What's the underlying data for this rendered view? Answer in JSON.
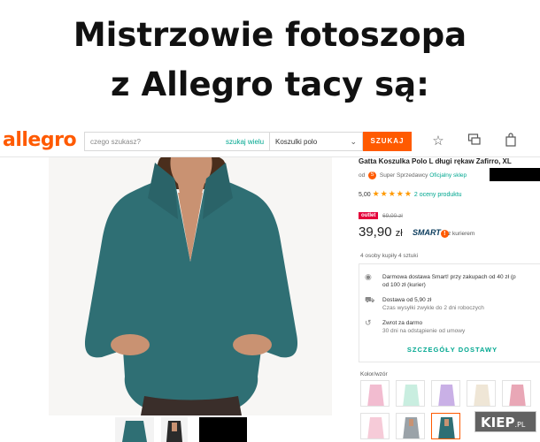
{
  "meme": {
    "line1": "Mistrzowie fotoszopa",
    "line2": "z Allegro tacy są:"
  },
  "header": {
    "logo": "allegro",
    "search_placeholder": "czego szukasz?",
    "search_link": "szukaj wielu",
    "category": "Koszulki polo",
    "search_button": "SZUKAJ",
    "icons": [
      "star-icon",
      "chat-icon",
      "bag-icon"
    ]
  },
  "product": {
    "title": "Gatta Koszulka Polo L długi rękaw Zafirro, XL",
    "seller_prefix": "od",
    "super_seller": "Super Sprzedawcy",
    "official_shop": "Oficjalny sklep",
    "rating_value": "5,00",
    "rating_stars": "★★★★★",
    "rating_count": "2 oceny produktu",
    "outlet_badge": "outlet",
    "old_price": "69,00 zł",
    "price_main": "39,90",
    "price_currency": "zł",
    "smart_label": "SMART",
    "smart_badge": "!",
    "courier_text": "z kurierem",
    "bought_text": "4 osoby kupiły 4 sztuki",
    "brand_color": "#ff5a00",
    "accent_color": "#00a790"
  },
  "delivery": {
    "smart_line1": "Darmowa dostawa Smart! przy zakupach od 40 zł (p",
    "smart_line2": "od 100 zł (kurier)",
    "cost_line1": "Dostawa od 5,90 zł",
    "cost_line2": "Czas wysyłki zwykle do 2 dni roboczych",
    "return_line1": "Zwrot za darmo",
    "return_line2": "30 dni na odstąpienie od umowy",
    "details_button": "SZCZEGÓŁY DOSTAWY"
  },
  "colors": {
    "label": "Kolor/wzór",
    "swatches": [
      "pink",
      "mint",
      "lavender",
      "cream",
      "rose",
      "light-pink",
      "light-pink-2",
      "grey",
      "teal",
      "other"
    ]
  },
  "watermark": {
    "main": "KIEP",
    "suffix": ".PL"
  }
}
